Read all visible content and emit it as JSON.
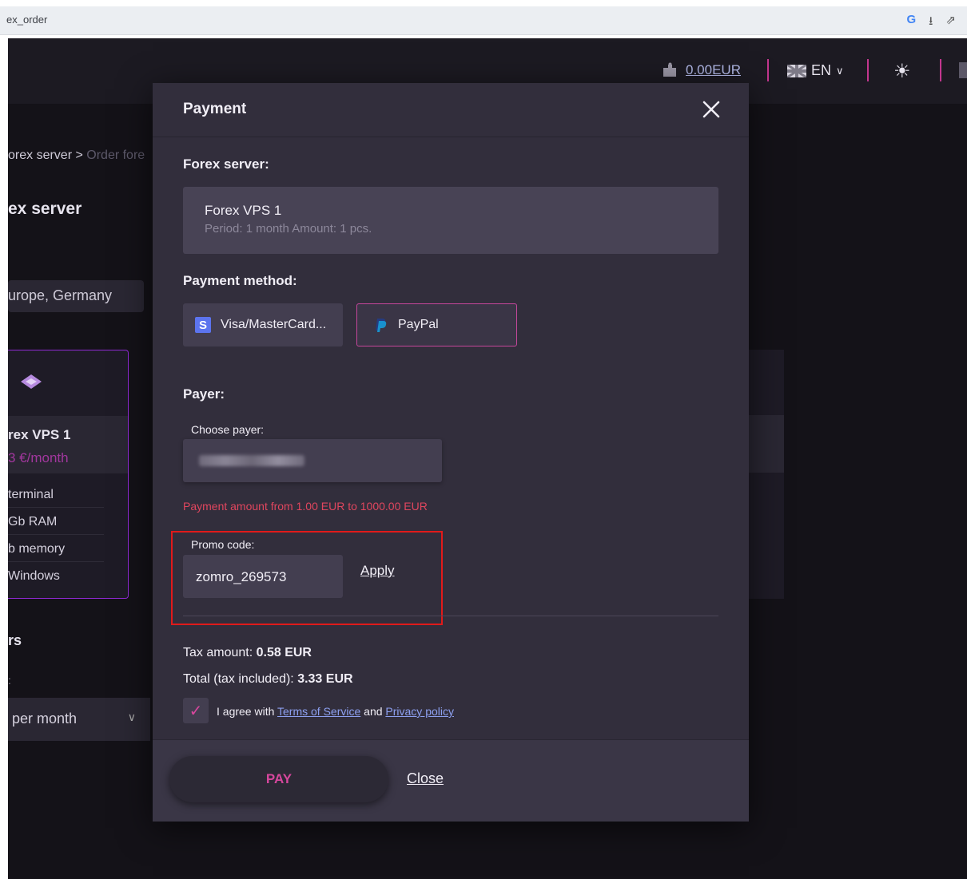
{
  "browser": {
    "url_text": "ex_order",
    "icons": [
      "google-icon",
      "install-icon",
      "share-icon"
    ]
  },
  "header": {
    "balance": "0.00EUR",
    "language": "EN",
    "icons": [
      "wallet-icon",
      "uk-flag-icon",
      "chevron-down-icon",
      "sun-icon",
      "mail-icon"
    ]
  },
  "background": {
    "breadcrumb_current": "orex server >",
    "breadcrumb_next": "Order fore",
    "page_title": "ex server",
    "location": "urope, Germany",
    "plan": {
      "name": "rex VPS 1",
      "price": "3 €/month",
      "features": [
        "terminal",
        "Gb RAM",
        "b memory",
        "Windows"
      ]
    },
    "section_title": "rs",
    "section_colon": ":",
    "period_select": "per month"
  },
  "modal": {
    "title": "Payment",
    "forex_label": "Forex server:",
    "server_name": "Forex VPS 1",
    "server_meta": "Period: 1 month   Amount: 1 pcs.",
    "payment_method_label": "Payment method:",
    "methods": [
      {
        "label": "Visa/MasterCard...",
        "icon": "s-icon",
        "selected": false
      },
      {
        "label": "PayPal",
        "icon": "paypal-icon",
        "selected": true
      }
    ],
    "payer_label": "Payer:",
    "choose_payer_label": "Choose payer:",
    "payment_range": "Payment amount from 1.00 EUR to 1000.00 EUR",
    "promo_label": "Promo code:",
    "promo_value": "zomro_269573",
    "apply_label": "Apply",
    "tax_label": "Tax amount:",
    "tax_value": "0.58 EUR",
    "total_label": "Total (tax included):",
    "total_value": "3.33 EUR",
    "agree_prefix": "I agree with",
    "terms_link": "Terms of Service",
    "agree_and": "and",
    "privacy_link": "Privacy policy",
    "agree_checked": true,
    "pay_label": "PAY",
    "close_label": "Close"
  },
  "colors": {
    "accent_pink": "#d6479d",
    "error_red": "#e0465e",
    "annotation_red": "#e01a1a",
    "modal_bg": "#322e3c"
  }
}
